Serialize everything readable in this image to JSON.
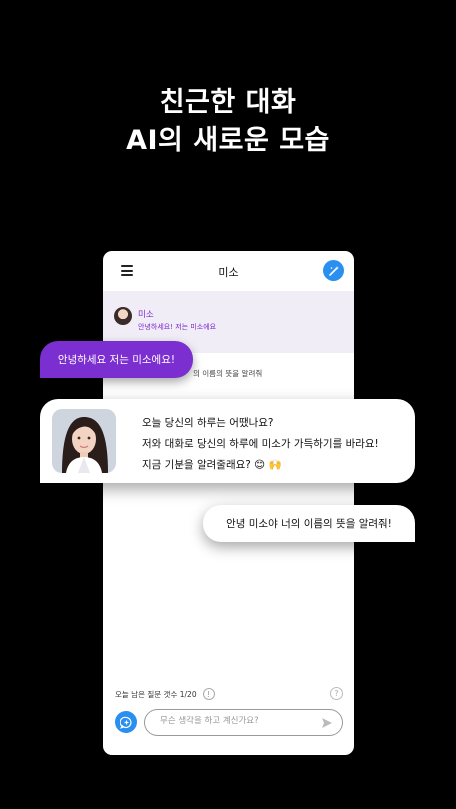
{
  "headline": {
    "line1": "친근한 대화",
    "line2": "AI의 새로운 모습"
  },
  "phone": {
    "title": "미소",
    "greeting_row": {
      "name": "미소",
      "message": "안녕하세요! 저는 미소에요"
    },
    "user_message_partial": "의 이름의 뜻을 알려줘",
    "quota": {
      "label": "오늘 남은 질문 갯수",
      "value": "1/20"
    },
    "input": {
      "placeholder": "무슨 생각을 하고 계신가요?"
    }
  },
  "overlays": {
    "purple_bubble": "안녕하세요 저는 미소에요!",
    "bot_message": {
      "line1": "오늘 당신의 하루는 어땠나요?",
      "line2": "저와 대화로 당신의 하루에 미소가 가득하기를 바라요!",
      "line3": "지금 기분을 알려줄래요? 😊 🙌"
    },
    "user_bubble": "안녕 미소야 너의 이름의 뜻을 알려줘!"
  },
  "colors": {
    "accent_purple": "#7c2fd0",
    "accent_blue": "#2b8ff0",
    "background": "#000000"
  }
}
